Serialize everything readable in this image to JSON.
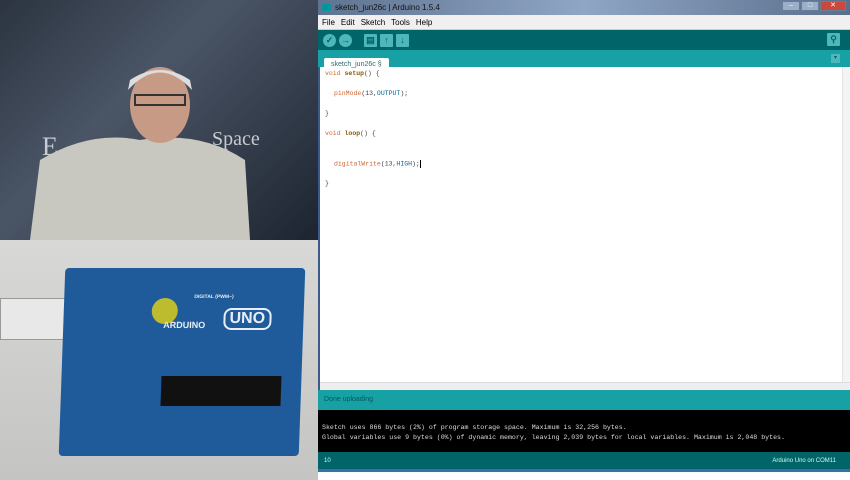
{
  "video": {
    "backdrop_text_1": "E",
    "backdrop_text_2": "Space",
    "board_brand": "ARDUINO",
    "board_model": "UNO",
    "board_header": "DIGITAL (PWM~)"
  },
  "window": {
    "title": "sketch_jun26c | Arduino 1.5.4",
    "min": "–",
    "max": "□",
    "close": "✕"
  },
  "menu": [
    "File",
    "Edit",
    "Sketch",
    "Tools",
    "Help"
  ],
  "toolbar": {
    "verify": "✓",
    "upload": "→",
    "new": "▤",
    "open": "↑",
    "save": "↓",
    "serial_monitor": "⚲"
  },
  "tab": {
    "label": "sketch_jun26c §",
    "menu": "▾"
  },
  "code": {
    "l1_void": "void ",
    "l1_fn": "setup",
    "l1_rest": "() {",
    "l2_fn": "pinMode",
    "l2_a": "(13,",
    "l2_c": "OUTPUT",
    "l2_b": ");",
    "l3": "}",
    "l4_void": "void ",
    "l4_fn": "loop",
    "l4_rest": "() {",
    "l5_fn": "digitalWrite",
    "l5_a": "(13,",
    "l5_c": "HIGH",
    "l5_b": ");",
    "l6": "}"
  },
  "status": "Done uploading",
  "console": [
    "Sketch uses 866 bytes (2%) of program storage space. Maximum is 32,256 bytes.",
    "Global variables use 9 bytes (0%) of dynamic memory, leaving 2,039 bytes for local variables. Maximum is 2,048 bytes."
  ],
  "footer": {
    "line": "10",
    "board": "Arduino Uno on COM11"
  }
}
